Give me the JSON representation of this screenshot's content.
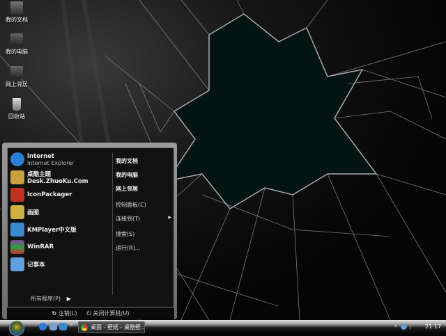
{
  "desktop_icons": [
    {
      "label": "我的文档",
      "icon": "my-documents-icon"
    },
    {
      "label": "我的电脑",
      "icon": "my-computer-icon"
    },
    {
      "label": "网上邻居",
      "icon": "network-icon"
    },
    {
      "label": "回收站",
      "icon": "recycle-bin-icon"
    }
  ],
  "start_menu": {
    "programs": [
      {
        "label": "Internet",
        "sub": "Internet Explorer",
        "icon": "ie-icon",
        "color": "#2a7fd8"
      },
      {
        "label": "桌酷主题Desk.ZhuoKu.Com",
        "icon": "zhuoku-icon",
        "color": "#c8a040"
      },
      {
        "label": "IconPackager",
        "icon": "iconpackager-icon",
        "color": "#c03020"
      },
      {
        "label": "画图",
        "icon": "paint-icon",
        "color": "#d0b040"
      },
      {
        "label": "KMPlayer中文版",
        "icon": "kmplayer-icon",
        "color": "#3a8ad0"
      },
      {
        "label": "WinRAR",
        "icon": "winrar-icon",
        "color": "#8040a0"
      },
      {
        "label": "记事本",
        "icon": "notepad-icon",
        "color": "#60a0e0"
      }
    ],
    "all_programs": "所有程序(P)",
    "right_items": [
      "我的文档",
      "我的电脑",
      "网上邻居",
      "控制面板(C)",
      "连接到(T)",
      "搜索(S)",
      "运行(R)..."
    ],
    "logoff": "注销(L)",
    "shutdown": "关闭计算机(U)"
  },
  "taskbar": {
    "task": "桌面 - 壁纸 - 桌酷壁...",
    "overflow": "»",
    "clock": "21:17",
    "tray_expand": "‹"
  }
}
